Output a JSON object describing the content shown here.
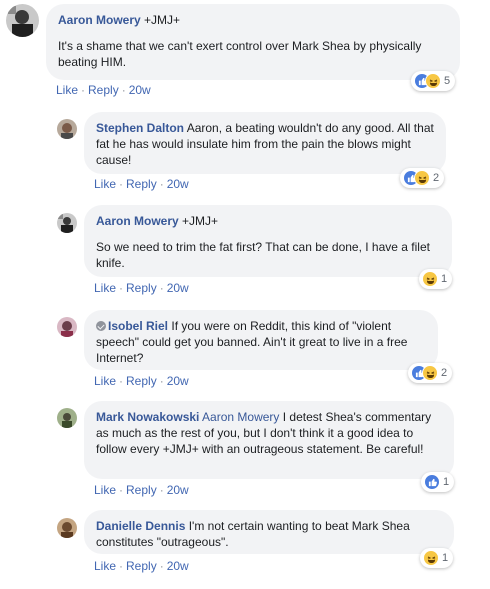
{
  "comments": [
    {
      "author": "Aaron Mowery",
      "segments": [
        " +JMJ+"
      ],
      "body": "It's a shame that we can't exert control over Mark Shea by physically beating HIM.",
      "actions": {
        "like": "Like",
        "reply": "Reply",
        "time": "20w",
        "sep": "·"
      },
      "reactions": {
        "types": [
          "like",
          "haha"
        ],
        "count": "5"
      }
    },
    {
      "author": "Stephen Dalton",
      "body": " Aaron, a beating wouldn't do any good. All that fat he has would insulate him from the pain the blows might cause!",
      "actions": {
        "like": "Like",
        "reply": "Reply",
        "time": "20w",
        "sep": "·"
      },
      "reactions": {
        "types": [
          "like",
          "haha"
        ],
        "count": "2"
      }
    },
    {
      "author": "Aaron Mowery",
      "segments": [
        " +JMJ+"
      ],
      "body": "So we need to trim the fat first? That can be done, I have a filet knife.",
      "actions": {
        "like": "Like",
        "reply": "Reply",
        "time": "20w",
        "sep": "·"
      },
      "reactions": {
        "types": [
          "haha"
        ],
        "count": "1"
      }
    },
    {
      "author": "Isobel Riel",
      "body": " If you were on Reddit, this kind of \"violent speech\" could get you banned. Ain't it great to live in a free Internet?",
      "actions": {
        "like": "Like",
        "reply": "Reply",
        "time": "20w",
        "sep": "·"
      },
      "reactions": {
        "types": [
          "like",
          "haha"
        ],
        "count": "2"
      }
    },
    {
      "author": "Mark Nowakowski",
      "mention": "Aaron Mowery",
      "body": " I detest Shea's commentary as much as the rest of you, but I don't think it a good idea to follow every +JMJ+ with an outrageous statement. Be careful!",
      "actions": {
        "like": "Like",
        "reply": "Reply",
        "time": "20w",
        "sep": "·"
      },
      "reactions": {
        "types": [
          "like"
        ],
        "count": "1"
      }
    },
    {
      "author": "Danielle Dennis",
      "body": " I'm not certain wanting to beat Mark Shea constitutes \"outrageous\".",
      "actions": {
        "like": "Like",
        "reply": "Reply",
        "time": "20w",
        "sep": "·"
      },
      "reactions": {
        "types": [
          "haha"
        ],
        "count": "1"
      }
    }
  ],
  "colors": {
    "link": "#385898",
    "action": "#4267b2",
    "bubble": "#f2f3f5",
    "like": "#4a7dde",
    "haha": "#f7c744"
  }
}
